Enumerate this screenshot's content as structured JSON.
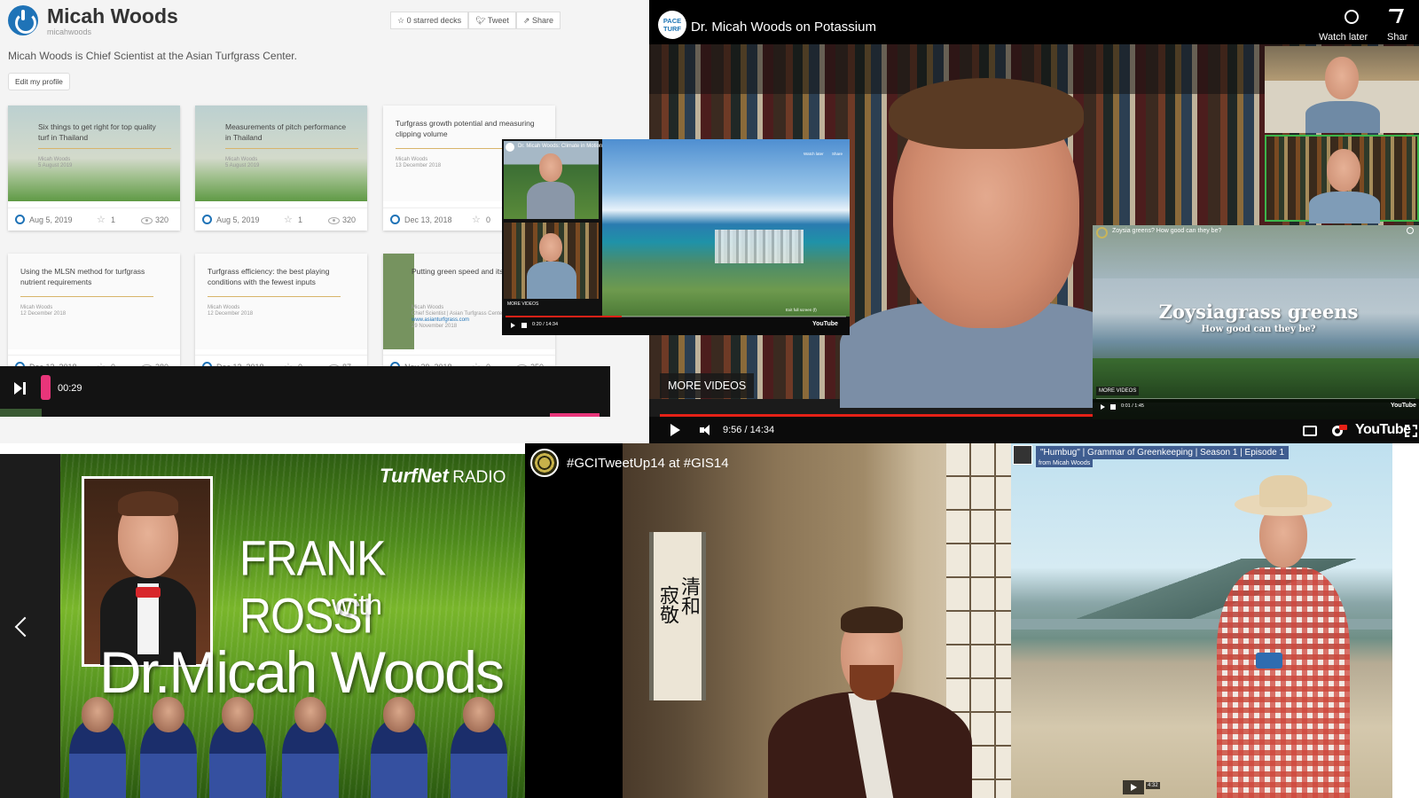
{
  "colors": {
    "speakerdeck_blue": "#1f73b7",
    "youtube_red": "#e62117",
    "pink_accent": "#e8357a"
  },
  "profile": {
    "name": "Micah Woods",
    "handle": "micahwoods",
    "bio": "Micah Woods is Chief Scientist at the Asian Turfgrass Center.",
    "edit_button": "Edit my profile",
    "actions": {
      "starred": "0 starred decks",
      "tweet": "Tweet",
      "share": "Share"
    },
    "decks": [
      {
        "title": "Six things to get right for top quality turf in Thailand",
        "date": "Aug 5, 2019",
        "stars": "1",
        "views": "320",
        "author": "Micah Woods",
        "subdate": "5 August 2019",
        "thumb": "photo"
      },
      {
        "title": "Measurements of pitch performance in Thailand",
        "date": "Aug 5, 2019",
        "stars": "1",
        "views": "320",
        "author": "Micah Woods",
        "subdate": "5 August 2019",
        "thumb": "photo"
      },
      {
        "title": "Turfgrass growth potential and measuring clipping volume",
        "date": "Dec 13, 2018",
        "stars": "0",
        "views": "",
        "author": "Micah Woods",
        "subdate": "13 December 2018",
        "thumb": "white"
      },
      {
        "title": "Using the MLSN method for turfgrass nutrient requirements",
        "date": "Dec 12, 2018",
        "stars": "0",
        "views": "380",
        "author": "Micah Woods",
        "subdate": "12 December 2018",
        "thumb": "white"
      },
      {
        "title": "Turfgrass efficiency: the best playing conditions with the fewest inputs",
        "date": "Dec 12, 2018",
        "stars": "0",
        "views": "87",
        "author": "Micah Woods",
        "subdate": "12 December 2018",
        "thumb": "white"
      },
      {
        "title": "Putting green speed and its variability",
        "date": "Nov 29, 2018",
        "stars": "0",
        "views": "250",
        "author": "Micah Woods",
        "subdate": "29 November 2018",
        "thumb": "green",
        "extra1": "Chief Scientist | Asian Turfgrass Center",
        "extra2": "www.asianturfgrass.com"
      }
    ]
  },
  "audio_bar": {
    "time": "00:29"
  },
  "potassium_video": {
    "channel_badge": "PACE TURF",
    "title": "Dr. Micah Woods on Potassium",
    "watch_later": "Watch later",
    "share": "Shar",
    "more_videos": "MORE VIDEOS",
    "time": "9:56 / 14:34",
    "progress": 0.683,
    "youtube_logo": "YouTube"
  },
  "climate_video": {
    "title": "Dr. Micah Woods: Climate in Motion",
    "watch_later": "Watch later",
    "share": "Share",
    "more_videos": "MORE VIDEOS",
    "time": "0:20 / 14:34",
    "exit_full": "Exit full screen (f)",
    "youtube_logo": "YouTube"
  },
  "zoysia_video": {
    "header": "Zoysia greens? How good can they be?",
    "headline": "Zoysiagrass greens",
    "subline": "How good can they be?",
    "more_videos": "MORE VIDEOS",
    "time": "0:01 / 1:45",
    "youtube_logo": "YouTube"
  },
  "turfnet": {
    "brand": "TurfNet",
    "brand_suffix": "RADIO",
    "guest": "FRANK ROSSI",
    "with": "with",
    "host": "Dr.Micah Woods"
  },
  "tweetup": {
    "title": "#GCITweetUp14 at #GIS14",
    "kanji_col1": "清和",
    "kanji_col2": "寂敬"
  },
  "humbug": {
    "title": "\"Humbug\" | Grammar of Greenkeeping | Season 1 | Episode 1",
    "from": "from Micah Woods",
    "time": "4:32"
  }
}
